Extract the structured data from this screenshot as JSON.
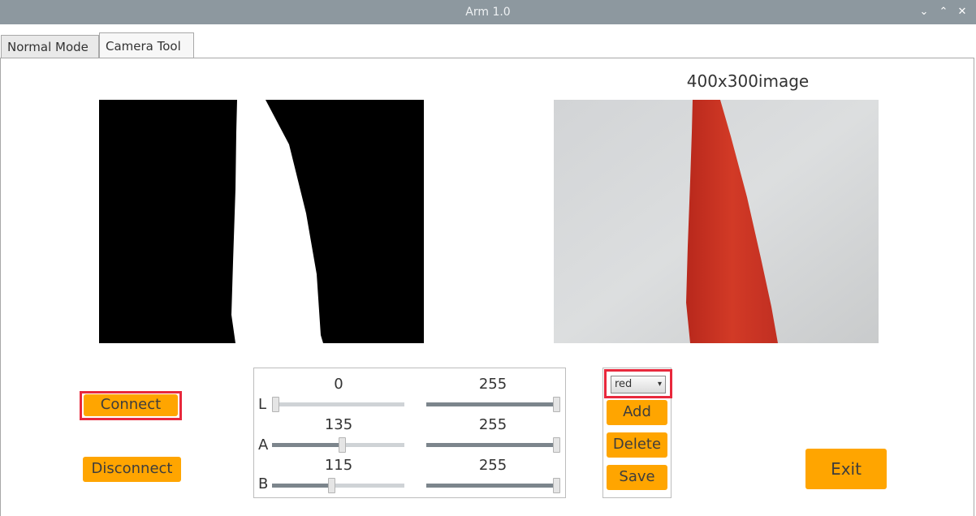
{
  "window": {
    "title": "Arm 1.0"
  },
  "tabs": [
    {
      "label": "Normal Mode"
    },
    {
      "label": "Camera Tool"
    }
  ],
  "image": {
    "label": "400x300image"
  },
  "buttons": {
    "connect": "Connect",
    "disconnect": "Disconnect",
    "add": "Add",
    "delete": "Delete",
    "save": "Save",
    "exit": "Exit"
  },
  "color_select": {
    "value": "red"
  },
  "sliders": {
    "L": {
      "label": "L",
      "min_value": "0",
      "max_value": "255",
      "min_fraction": 0.0,
      "max_fraction": 1.0
    },
    "A": {
      "label": "A",
      "min_value": "135",
      "max_value": "255",
      "min_fraction": 0.53,
      "max_fraction": 1.0
    },
    "B": {
      "label": "B",
      "min_value": "115",
      "max_value": "255",
      "min_fraction": 0.45,
      "max_fraction": 1.0
    }
  },
  "colors": {
    "accent": "#ffa500",
    "highlight": "#e8283c",
    "titlebar": "#8d989f"
  }
}
